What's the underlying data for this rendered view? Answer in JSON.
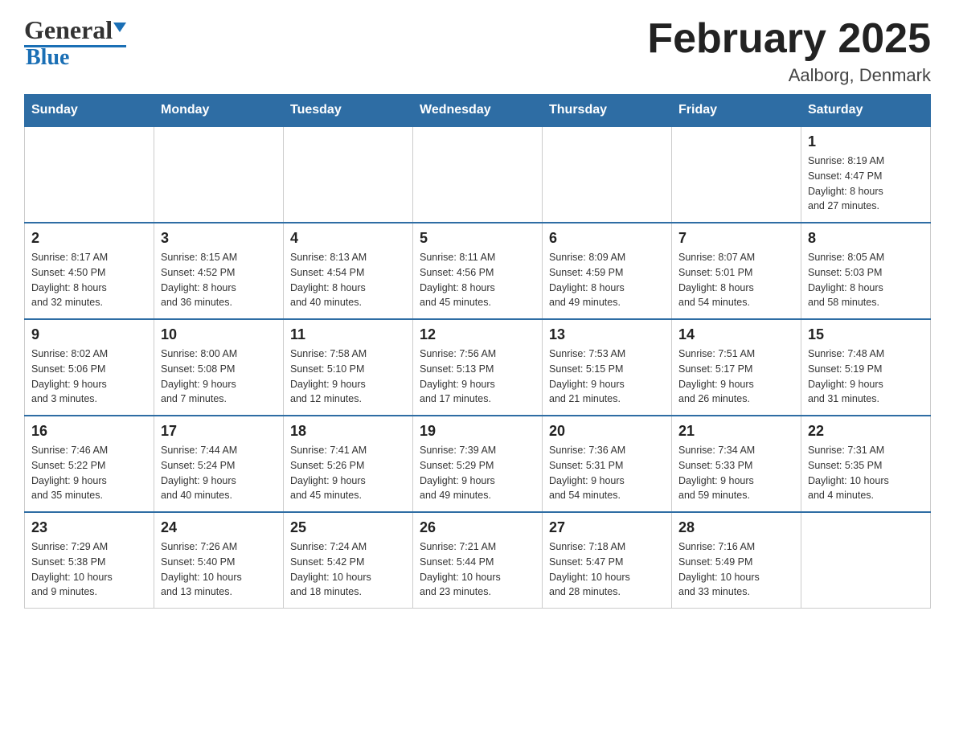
{
  "header": {
    "logo_general": "General",
    "logo_blue": "Blue",
    "month_title": "February 2025",
    "location": "Aalborg, Denmark"
  },
  "days_of_week": [
    "Sunday",
    "Monday",
    "Tuesday",
    "Wednesday",
    "Thursday",
    "Friday",
    "Saturday"
  ],
  "weeks": [
    [
      {
        "day": "",
        "info": ""
      },
      {
        "day": "",
        "info": ""
      },
      {
        "day": "",
        "info": ""
      },
      {
        "day": "",
        "info": ""
      },
      {
        "day": "",
        "info": ""
      },
      {
        "day": "",
        "info": ""
      },
      {
        "day": "1",
        "info": "Sunrise: 8:19 AM\nSunset: 4:47 PM\nDaylight: 8 hours\nand 27 minutes."
      }
    ],
    [
      {
        "day": "2",
        "info": "Sunrise: 8:17 AM\nSunset: 4:50 PM\nDaylight: 8 hours\nand 32 minutes."
      },
      {
        "day": "3",
        "info": "Sunrise: 8:15 AM\nSunset: 4:52 PM\nDaylight: 8 hours\nand 36 minutes."
      },
      {
        "day": "4",
        "info": "Sunrise: 8:13 AM\nSunset: 4:54 PM\nDaylight: 8 hours\nand 40 minutes."
      },
      {
        "day": "5",
        "info": "Sunrise: 8:11 AM\nSunset: 4:56 PM\nDaylight: 8 hours\nand 45 minutes."
      },
      {
        "day": "6",
        "info": "Sunrise: 8:09 AM\nSunset: 4:59 PM\nDaylight: 8 hours\nand 49 minutes."
      },
      {
        "day": "7",
        "info": "Sunrise: 8:07 AM\nSunset: 5:01 PM\nDaylight: 8 hours\nand 54 minutes."
      },
      {
        "day": "8",
        "info": "Sunrise: 8:05 AM\nSunset: 5:03 PM\nDaylight: 8 hours\nand 58 minutes."
      }
    ],
    [
      {
        "day": "9",
        "info": "Sunrise: 8:02 AM\nSunset: 5:06 PM\nDaylight: 9 hours\nand 3 minutes."
      },
      {
        "day": "10",
        "info": "Sunrise: 8:00 AM\nSunset: 5:08 PM\nDaylight: 9 hours\nand 7 minutes."
      },
      {
        "day": "11",
        "info": "Sunrise: 7:58 AM\nSunset: 5:10 PM\nDaylight: 9 hours\nand 12 minutes."
      },
      {
        "day": "12",
        "info": "Sunrise: 7:56 AM\nSunset: 5:13 PM\nDaylight: 9 hours\nand 17 minutes."
      },
      {
        "day": "13",
        "info": "Sunrise: 7:53 AM\nSunset: 5:15 PM\nDaylight: 9 hours\nand 21 minutes."
      },
      {
        "day": "14",
        "info": "Sunrise: 7:51 AM\nSunset: 5:17 PM\nDaylight: 9 hours\nand 26 minutes."
      },
      {
        "day": "15",
        "info": "Sunrise: 7:48 AM\nSunset: 5:19 PM\nDaylight: 9 hours\nand 31 minutes."
      }
    ],
    [
      {
        "day": "16",
        "info": "Sunrise: 7:46 AM\nSunset: 5:22 PM\nDaylight: 9 hours\nand 35 minutes."
      },
      {
        "day": "17",
        "info": "Sunrise: 7:44 AM\nSunset: 5:24 PM\nDaylight: 9 hours\nand 40 minutes."
      },
      {
        "day": "18",
        "info": "Sunrise: 7:41 AM\nSunset: 5:26 PM\nDaylight: 9 hours\nand 45 minutes."
      },
      {
        "day": "19",
        "info": "Sunrise: 7:39 AM\nSunset: 5:29 PM\nDaylight: 9 hours\nand 49 minutes."
      },
      {
        "day": "20",
        "info": "Sunrise: 7:36 AM\nSunset: 5:31 PM\nDaylight: 9 hours\nand 54 minutes."
      },
      {
        "day": "21",
        "info": "Sunrise: 7:34 AM\nSunset: 5:33 PM\nDaylight: 9 hours\nand 59 minutes."
      },
      {
        "day": "22",
        "info": "Sunrise: 7:31 AM\nSunset: 5:35 PM\nDaylight: 10 hours\nand 4 minutes."
      }
    ],
    [
      {
        "day": "23",
        "info": "Sunrise: 7:29 AM\nSunset: 5:38 PM\nDaylight: 10 hours\nand 9 minutes."
      },
      {
        "day": "24",
        "info": "Sunrise: 7:26 AM\nSunset: 5:40 PM\nDaylight: 10 hours\nand 13 minutes."
      },
      {
        "day": "25",
        "info": "Sunrise: 7:24 AM\nSunset: 5:42 PM\nDaylight: 10 hours\nand 18 minutes."
      },
      {
        "day": "26",
        "info": "Sunrise: 7:21 AM\nSunset: 5:44 PM\nDaylight: 10 hours\nand 23 minutes."
      },
      {
        "day": "27",
        "info": "Sunrise: 7:18 AM\nSunset: 5:47 PM\nDaylight: 10 hours\nand 28 minutes."
      },
      {
        "day": "28",
        "info": "Sunrise: 7:16 AM\nSunset: 5:49 PM\nDaylight: 10 hours\nand 33 minutes."
      },
      {
        "day": "",
        "info": ""
      }
    ]
  ]
}
